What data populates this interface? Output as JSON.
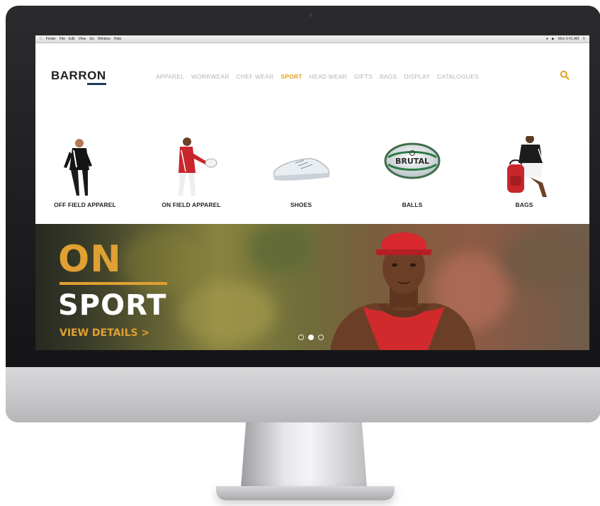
{
  "menubar": {
    "items": [
      "Finder",
      "File",
      "Edit",
      "View",
      "Go",
      "Window",
      "Help"
    ],
    "status": "Mon 9:41 AM"
  },
  "site": {
    "logo_prefix": "BARR",
    "logo_suffix": "ON",
    "nav": [
      {
        "label": "APPAREL",
        "active": false
      },
      {
        "label": "WORKWEAR",
        "active": false
      },
      {
        "label": "CHEF WEAR",
        "active": false
      },
      {
        "label": "SPORT",
        "active": true
      },
      {
        "label": "HEAD WEAR",
        "active": false
      },
      {
        "label": "GIFTS",
        "active": false
      },
      {
        "label": "BAGS",
        "active": false
      },
      {
        "label": "DISPLAY",
        "active": false
      },
      {
        "label": "CATALOGUES",
        "active": false
      }
    ],
    "search_icon": "search-icon"
  },
  "categories": [
    {
      "label": "OFF FIELD APPAREL",
      "icon": "off-field-apparel-image"
    },
    {
      "label": "ON FIELD APPAREL",
      "icon": "on-field-apparel-image"
    },
    {
      "label": "SHOES",
      "icon": "shoe-image"
    },
    {
      "label": "BALLS",
      "icon": "ball-image",
      "ball_brand": "BRUTAL"
    },
    {
      "label": "BAGS",
      "icon": "bag-image"
    }
  ],
  "hero": {
    "title_top": "ON",
    "title_bottom": "SPORT",
    "cta": "VIEW DETAILS >",
    "slides": 3,
    "active_slide": 2
  },
  "colors": {
    "accent": "#e0a032",
    "nav_inactive": "#b4b4b4",
    "nav_active": "#e0a020",
    "logo_underline": "#1f3d5a",
    "bezel": "#151517",
    "chin": "#c9c9cc"
  }
}
